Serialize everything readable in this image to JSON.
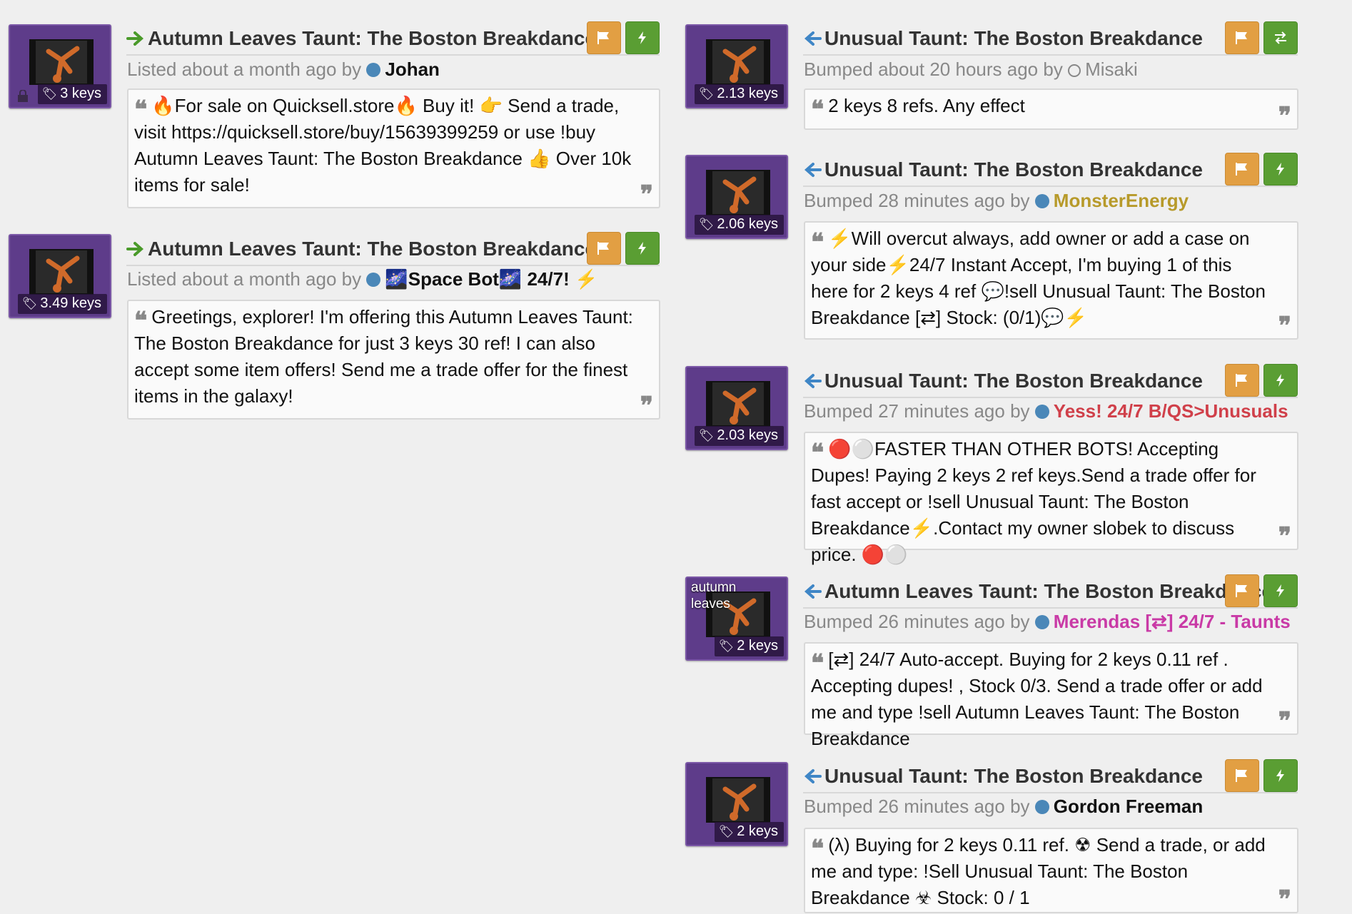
{
  "listings_left": [
    {
      "title": "Autumn Leaves Taunt: The Boston Breakdance",
      "direction": "sell",
      "price": "3 keys",
      "meta_prefix": "Listed about a month ago by",
      "user": "Johan",
      "user_color": "#111111",
      "dot": "filled",
      "message": "🔥For sale on Quicksell.store🔥 Buy it! 👉 Send a trade, visit https://quicksell.store/buy/15639399259 or use !buy Autumn Leaves Taunt: The Boston Breakdance 👍 Over 10k items for sale!",
      "buttons": [
        "flag-icon",
        "bolt-icon"
      ],
      "lock": true
    },
    {
      "title": "Autumn Leaves Taunt: The Boston Breakdance",
      "direction": "sell",
      "price": "3.49 keys",
      "meta_prefix": "Listed about a month ago by",
      "user": "🌌Space Bot🌌 24/7! ⚡",
      "user_color": "#111111",
      "dot": "filled",
      "message": "Greetings, explorer! I'm offering this Autumn Leaves Taunt: The Boston Breakdance for just 3 keys 30 ref! I can also accept some item offers! Send me a trade offer for the finest items in the galaxy!",
      "buttons": [
        "flag-icon",
        "bolt-icon"
      ],
      "lock": false
    }
  ],
  "listings_right": [
    {
      "title": "Unusual Taunt: The Boston Breakdance",
      "direction": "buy",
      "price": "2.13 keys",
      "meta_prefix": "Bumped about 20 hours ago by",
      "user": "Misaki",
      "user_color": "#888888",
      "dot": "hollow",
      "message": "2 keys 8 refs. Any effect",
      "buttons": [
        "flag-icon",
        "trade-icon"
      ]
    },
    {
      "title": "Unusual Taunt: The Boston Breakdance",
      "direction": "buy",
      "price": "2.06 keys",
      "meta_prefix": "Bumped 28 minutes ago by",
      "user": "MonsterEnergy",
      "user_color": "#b79a2a",
      "dot": "filled",
      "message": "⚡Will overcut always, add owner or add a case on your side⚡24/7 Instant Accept, I'm buying 1 of this here for 2 keys 4 ref 💬!sell Unusual Taunt: The Boston Breakdance [⇄] Stock: (0/1)💬⚡",
      "buttons": [
        "flag-icon",
        "bolt-icon"
      ]
    },
    {
      "title": "Unusual Taunt: The Boston Breakdance",
      "direction": "buy",
      "price": "2.03 keys",
      "meta_prefix": "Bumped 27 minutes ago by",
      "user": "Yess! 24/7 B/QS>Unusuals",
      "user_color": "#d0404a",
      "dot": "filled",
      "message": "🔴⚪FASTER THAN OTHER BOTS! Accepting Dupes! Paying 2 keys 2 ref keys.Send a trade offer for fast accept or !sell Unusual Taunt: The Boston Breakdance⚡.Contact my owner slobek to discuss price. 🔴⚪",
      "buttons": [
        "flag-icon",
        "bolt-icon"
      ]
    },
    {
      "title": "Autumn Leaves Taunt: The Boston Breakdance",
      "direction": "buy",
      "price": "2 keys",
      "effect_label": "autumn leaves",
      "meta_prefix": "Bumped 26 minutes ago by",
      "user": "Merendas [⇄] 24/7 - Taunts",
      "user_color": "#c93aa6",
      "dot": "filled",
      "message": "[⇄] 24/7 Auto-accept. Buying for 2 keys 0.11 ref . Accepting dupes! , Stock 0/3. Send a trade offer or add me and type !sell Autumn Leaves Taunt: The Boston Breakdance",
      "buttons": [
        "flag-icon",
        "bolt-icon"
      ]
    },
    {
      "title": "Unusual Taunt: The Boston Breakdance",
      "direction": "buy",
      "price": "2 keys",
      "meta_prefix": "Bumped 26 minutes ago by",
      "user": "Gordon Freeman",
      "user_color": "#111111",
      "dot": "filled",
      "message": "(λ) Buying for 2 keys 0.11 ref. ☢ Send a trade, or add me and type: !Sell Unusual Taunt: The Boston Breakdance ☣ Stock: 0 / 1",
      "buttons": [
        "flag-icon",
        "bolt-icon"
      ]
    }
  ],
  "colors": {
    "sell_arrow": "#4a9a2a",
    "buy_arrow": "#3f86c6",
    "flag_button": "#e29f43",
    "bolt_button": "#5a9e33",
    "thumb_bg": "#5e3c8a"
  }
}
